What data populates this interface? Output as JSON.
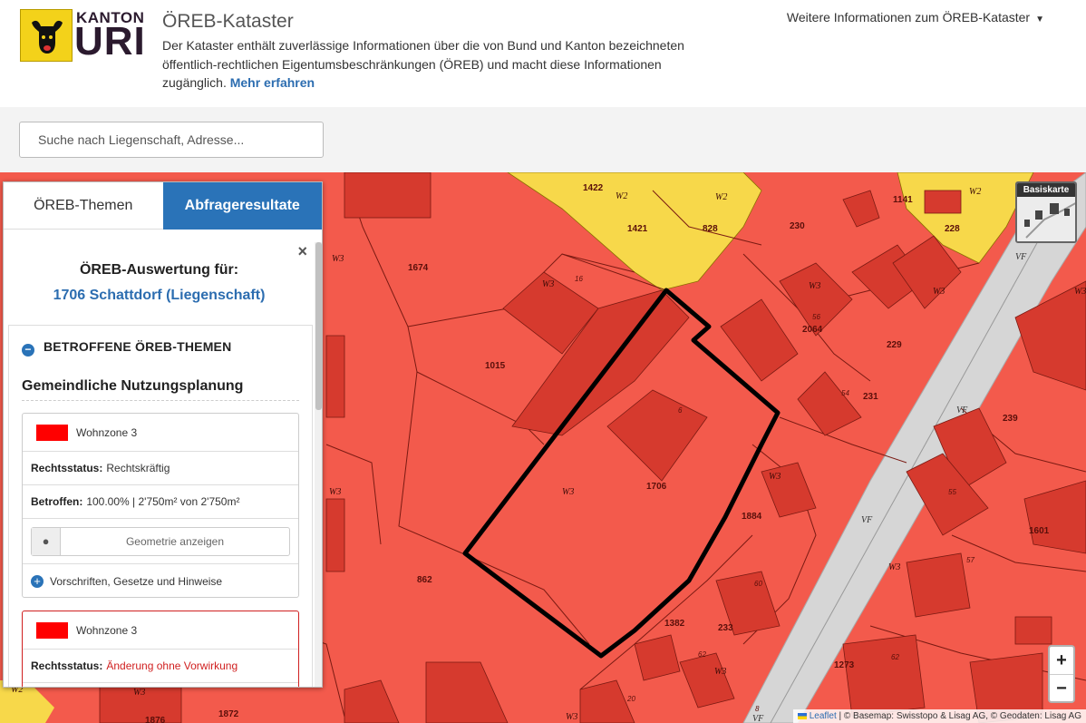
{
  "header": {
    "logo_top": "KANTON",
    "logo_main": "URI",
    "title": "ÖREB-Kataster",
    "description": "Der Kataster enthält zuverlässige Informationen über die von Bund und Kanton bezeichneten öffentlich-rechtlichen Eigentumsbeschränkungen (ÖREB) und macht diese Informationen zugänglich.",
    "more_link": "Mehr erfahren",
    "info_menu": "Weitere Informationen zum ÖREB-Kataster"
  },
  "search": {
    "placeholder": "Suche nach Liegenschaft, Adresse..."
  },
  "panel": {
    "tabs": [
      "ÖREB-Themen",
      "Abfrageresultate"
    ],
    "close": "×",
    "title": "ÖREB-Auswertung für:",
    "subtitle": "1706 Schattdorf (Liegenschaft)",
    "section_header": "BETROFFENE ÖREB-THEMEN",
    "group_title": "Gemeindliche Nutzungsplanung",
    "cards": [
      {
        "zone": "Wohnzone 3",
        "status_label": "Rechtsstatus:",
        "status_value": "Rechtskräftig",
        "affected_label": "Betroffen:",
        "affected_value": "100.00% | 2'750m² von 2'750m²",
        "geometry_button": "Geometrie anzeigen",
        "regulations": "Vorschriften, Gesetze und Hinweise"
      },
      {
        "zone": "Wohnzone 3",
        "status_label": "Rechtsstatus:",
        "status_value": "Änderung ohne Vorwirkung"
      }
    ]
  },
  "map": {
    "basemap_label": "Basiskarte",
    "zoom_in": "+",
    "zoom_out": "−",
    "attribution_leaflet": "Leaflet",
    "attribution_rest": " | © Basemap: Swisstopo & Lisag AG, © Geodaten: Lisag AG",
    "labels": {
      "parcels": [
        "1422",
        "1421",
        "828",
        "230",
        "1141",
        "228",
        "1674",
        "1015",
        "229",
        "231",
        "239",
        "1706",
        "1884",
        "862",
        "1601",
        "1382",
        "233",
        "1273",
        "1872",
        "1876",
        "2064",
        "56",
        "54",
        "55",
        "57",
        "60",
        "62",
        "20",
        "6",
        "8",
        "16"
      ],
      "zones": [
        "W2",
        "W2",
        "W2",
        "W3",
        "W3",
        "W3",
        "W3",
        "W3",
        "W3",
        "W3",
        "W3",
        "W3",
        "W3",
        "W3",
        "W3",
        "W2"
      ],
      "roads": [
        "VF",
        "VF",
        "VF",
        "VF"
      ]
    },
    "colors": {
      "zone_w3": "#f35a4c",
      "zone_w2": "#f7d84a",
      "building": "#d63a2e",
      "road": "#d6d6d6",
      "parcel_outline": "#000000"
    }
  }
}
